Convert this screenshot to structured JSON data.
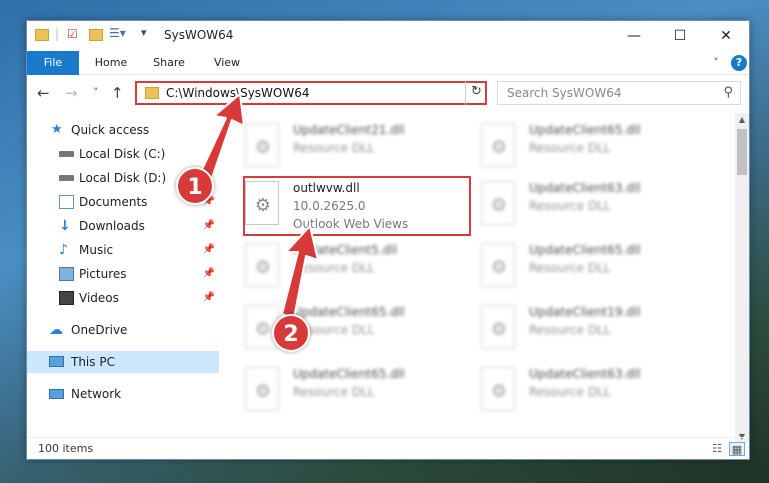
{
  "window": {
    "title": "SysWOW64",
    "controls": {
      "minimize": "—",
      "maximize": "☐",
      "close": "✕"
    }
  },
  "ribbon": {
    "tabs": [
      "File",
      "Home",
      "Share",
      "View"
    ],
    "help": "?"
  },
  "navigation": {
    "back": "←",
    "forward": "→",
    "recent": "˅",
    "up": "↑",
    "address_value": "C:\\Windows\\SysWOW64",
    "address_dropdown": "˅",
    "refresh": "↻"
  },
  "search": {
    "placeholder": "Search SysWOW64",
    "icon": "search-icon"
  },
  "sidebar": {
    "items": [
      {
        "label": "Quick access",
        "icon": "star-icon"
      },
      {
        "label": "Local Disk (C:)",
        "icon": "drive-icon"
      },
      {
        "label": "Local Disk (D:)",
        "icon": "drive-icon"
      },
      {
        "label": "Documents",
        "icon": "documents-icon",
        "pinned": true
      },
      {
        "label": "Downloads",
        "icon": "download-icon",
        "pinned": true
      },
      {
        "label": "Music",
        "icon": "music-icon",
        "pinned": true
      },
      {
        "label": "Pictures",
        "icon": "pictures-icon",
        "pinned": true
      },
      {
        "label": "Videos",
        "icon": "videos-icon",
        "pinned": true
      },
      {
        "label": "OneDrive",
        "icon": "cloud-icon"
      },
      {
        "label": "This PC",
        "icon": "computer-icon",
        "selected": true
      },
      {
        "label": "Network",
        "icon": "network-icon"
      }
    ]
  },
  "files": {
    "highlighted": {
      "name": "outlwvw.dll",
      "version": "10.0.2625.0",
      "description": "Outlook Web Views"
    },
    "background_tiles": [
      {
        "name": "UpdateClient21.dll",
        "type": "Resource DLL"
      },
      {
        "name": "UpdateClient65.dll",
        "type": "Resource DLL"
      },
      {
        "name": "UpdateClient63.dll",
        "type": "Resource DLL"
      },
      {
        "name": "UpdateClient5.dll",
        "type": "Resource DLL"
      },
      {
        "name": "UpdateClient65.dll",
        "type": "Resource DLL"
      },
      {
        "name": "UpdateClient65.dll",
        "type": "Resource DLL"
      },
      {
        "name": "UpdateClient19.dll",
        "type": "Resource DLL"
      },
      {
        "name": "UpdateClient65.dll",
        "type": "Resource DLL"
      },
      {
        "name": "UpdateClient63.dll",
        "type": "Resource DLL"
      }
    ]
  },
  "status": {
    "item_count": "100 items"
  },
  "annotations": {
    "step1": "1",
    "step2": "2",
    "color": "#d83a3a"
  }
}
